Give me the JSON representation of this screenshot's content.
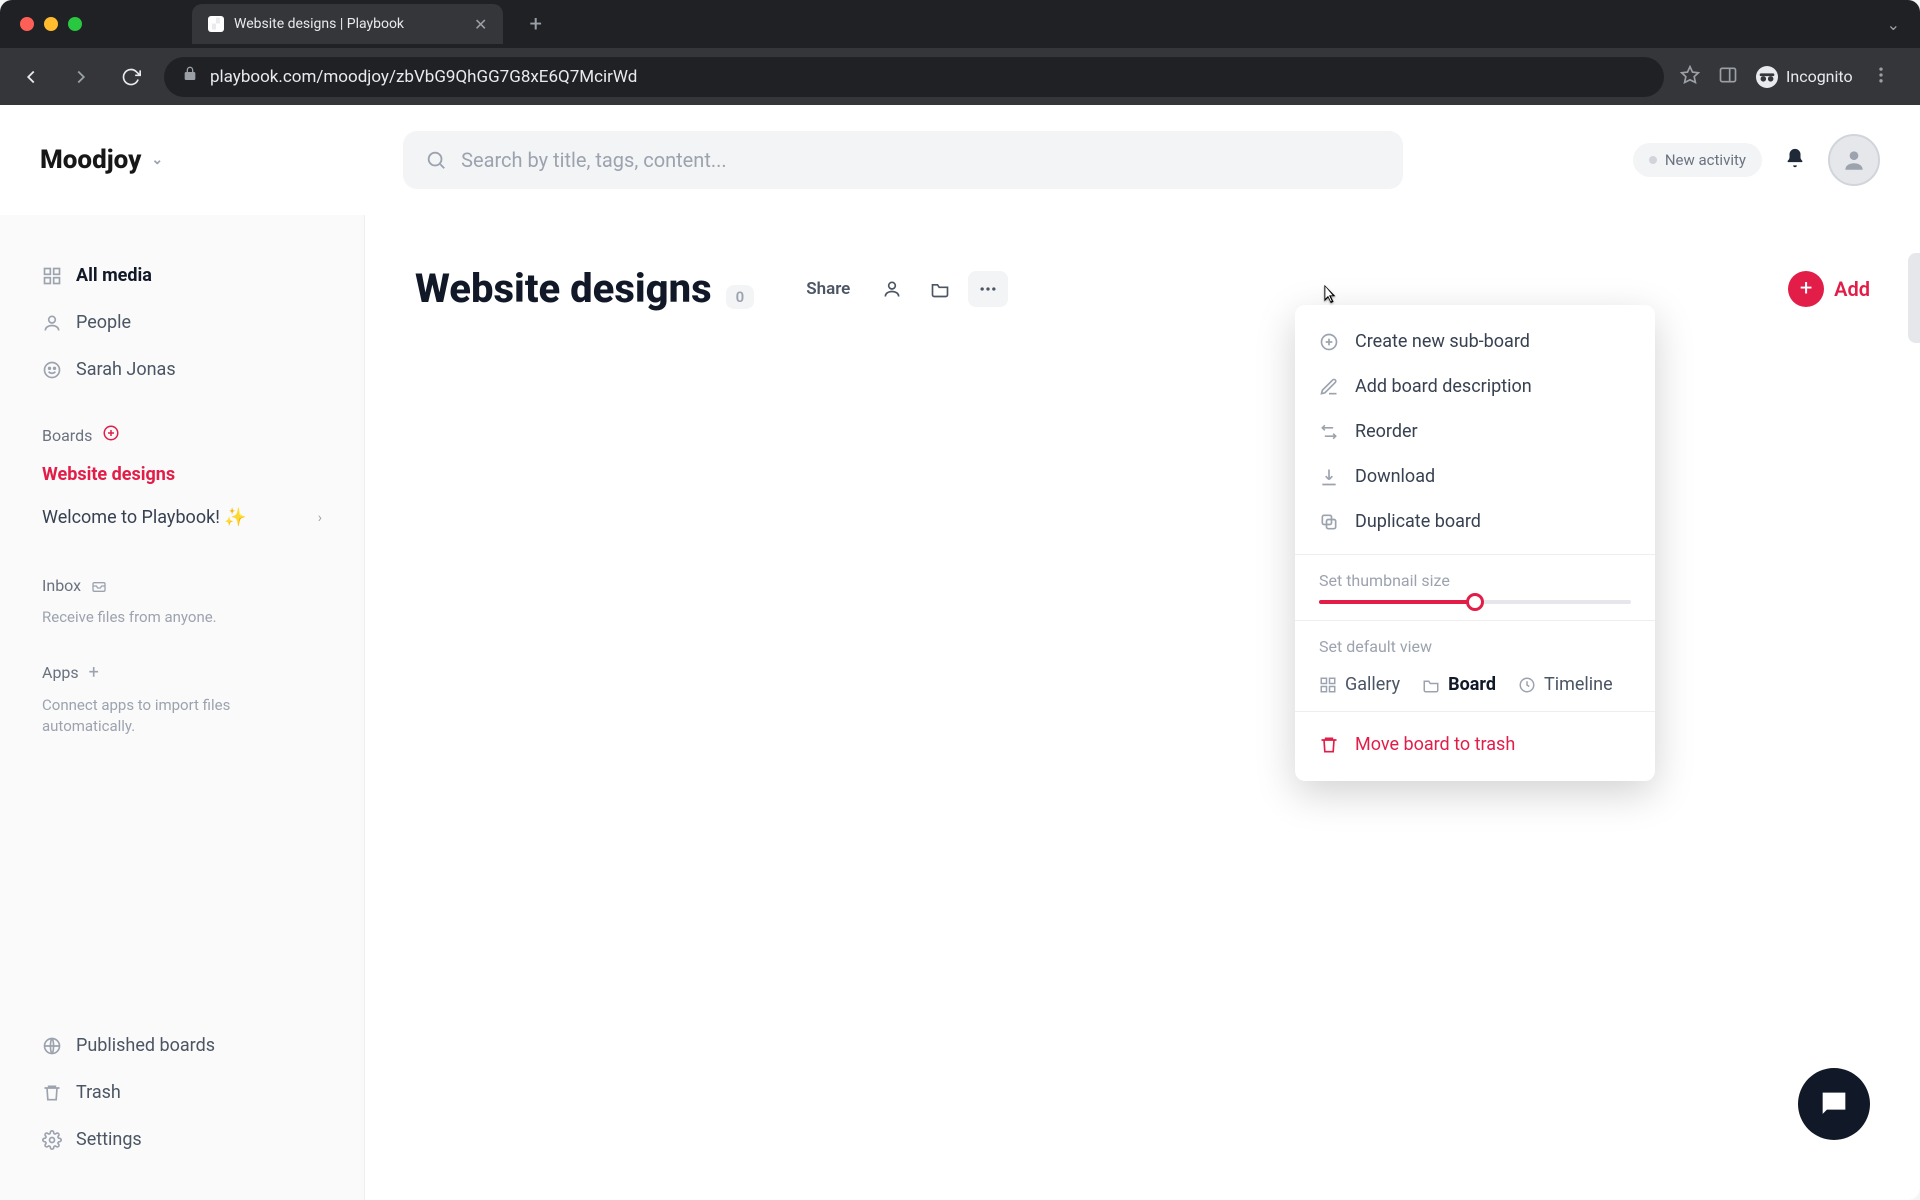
{
  "browser": {
    "tab_title": "Website designs | Playbook",
    "url": "playbook.com/moodjoy/zbVbG9QhGG7G8xE6Q7McirWd",
    "incognito_label": "Incognito"
  },
  "topbar": {
    "workspace": "Moodjoy",
    "search_placeholder": "Search by title, tags, content...",
    "activity_label": "New activity"
  },
  "sidebar": {
    "nav": [
      {
        "label": "All media"
      },
      {
        "label": "People"
      },
      {
        "label": "Sarah Jonas"
      }
    ],
    "boards_header": "Boards",
    "boards": [
      {
        "label": "Website designs",
        "active": true
      },
      {
        "label": "Welcome to Playbook! ✨",
        "expandable": true
      }
    ],
    "inbox_header": "Inbox",
    "inbox_hint": "Receive files from anyone.",
    "apps_header": "Apps",
    "apps_hint": "Connect apps to import files automatically.",
    "footer": [
      {
        "label": "Published boards"
      },
      {
        "label": "Trash"
      },
      {
        "label": "Settings"
      }
    ]
  },
  "board": {
    "title": "Website designs",
    "count": "0",
    "share_label": "Share",
    "add_label": "Add",
    "empty_tail": "."
  },
  "menu": {
    "items": [
      {
        "icon": "plus-circle",
        "label": "Create new sub-board"
      },
      {
        "icon": "pencil",
        "label": "Add board description"
      },
      {
        "icon": "reorder",
        "label": "Reorder"
      },
      {
        "icon": "download",
        "label": "Download"
      },
      {
        "icon": "duplicate",
        "label": "Duplicate board"
      }
    ],
    "thumb_label": "Set thumbnail size",
    "slider_percent": 50,
    "view_label": "Set default view",
    "views": [
      {
        "icon": "grid",
        "label": "Gallery",
        "selected": false
      },
      {
        "icon": "folder",
        "label": "Board",
        "selected": true
      },
      {
        "icon": "clock",
        "label": "Timeline",
        "selected": false
      }
    ],
    "trash_label": "Move board to trash"
  },
  "colors": {
    "accent": "#e11d48"
  }
}
